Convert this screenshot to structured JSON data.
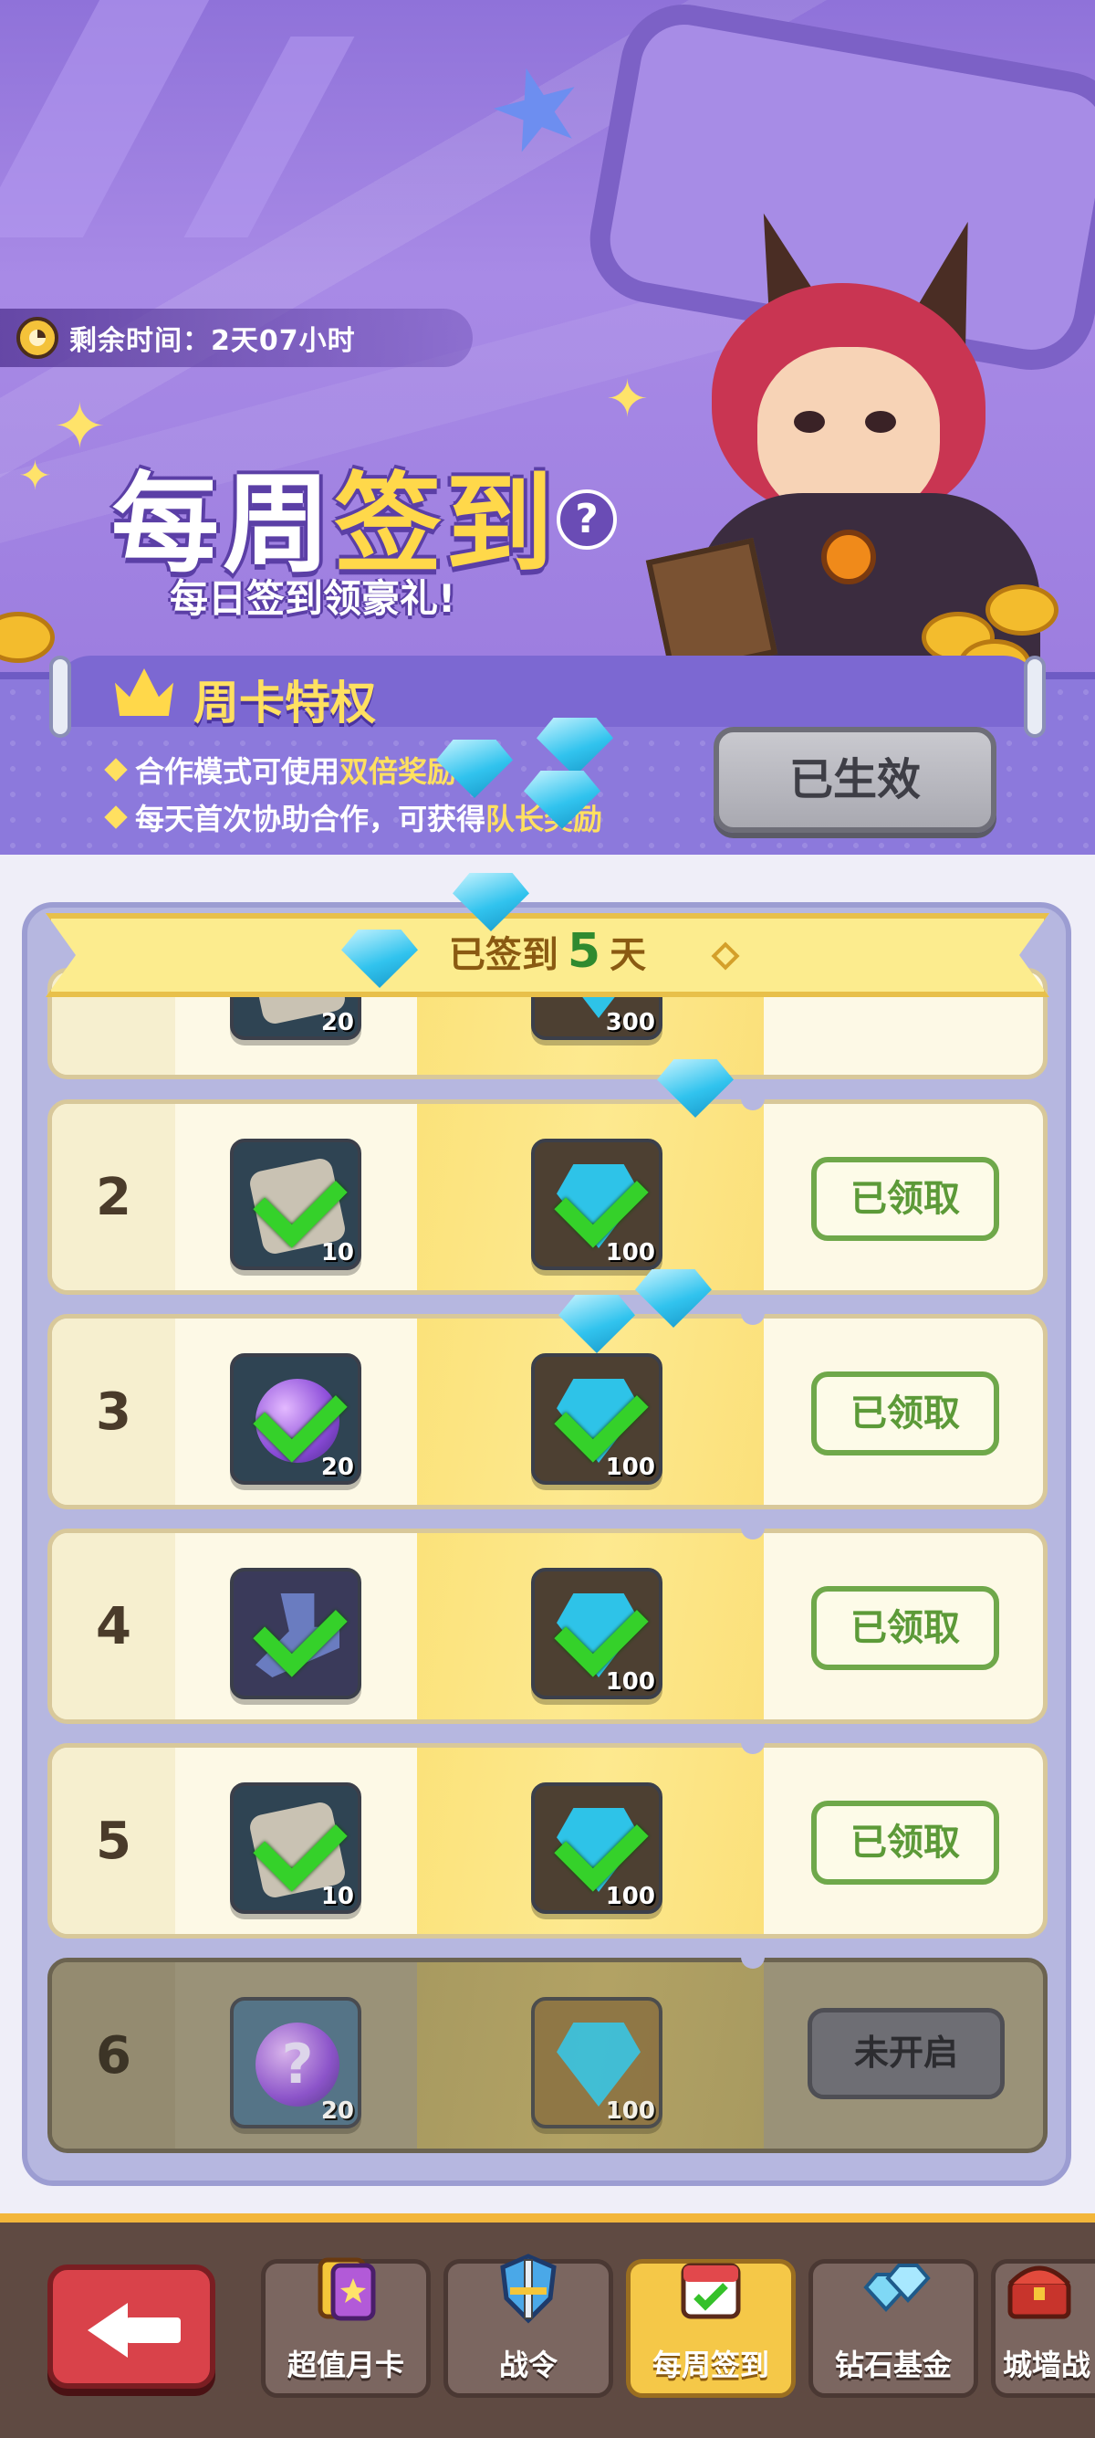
{
  "header": {
    "timer_label": "剩余时间：2天07小时",
    "title_part1": "每周",
    "title_part2": "签到",
    "help_icon": "question-icon",
    "help_glyph": "?",
    "subtitle": "每日签到领豪礼!"
  },
  "weekly_card": {
    "title": "周卡特权",
    "perk1_prefix": "合作模式可使用",
    "perk1_highlight": "双倍奖励",
    "perk2_prefix": "每天首次协助合作，可获得",
    "perk2_highlight": "队长奖励",
    "status_button": "已生效"
  },
  "progress": {
    "prefix": "已签到",
    "days": "5",
    "suffix": "天"
  },
  "rows": [
    {
      "day": "",
      "item1_qty": "20",
      "item2_qty": "300",
      "item1_icon": "scroll-icon",
      "item2_icon": "diamond-icon"
    },
    {
      "day": "2",
      "item1_qty": "10",
      "item2_qty": "100",
      "item1_icon": "scroll-icon",
      "item2_icon": "diamond-icon",
      "button": "已领取",
      "claimed": true
    },
    {
      "day": "3",
      "item1_qty": "20",
      "item2_qty": "100",
      "item1_icon": "mystery-orb-icon",
      "item2_icon": "diamond-icon",
      "button": "已领取",
      "claimed": true
    },
    {
      "day": "4",
      "item1_qty": "",
      "item2_qty": "100",
      "item1_icon": "hammer-icon",
      "item2_icon": "diamond-icon",
      "button": "已领取",
      "claimed": true
    },
    {
      "day": "5",
      "item1_qty": "10",
      "item2_qty": "100",
      "item1_icon": "scroll-icon",
      "item2_icon": "diamond-icon",
      "button": "已领取",
      "claimed": true
    },
    {
      "day": "6",
      "item1_qty": "20",
      "item2_qty": "100",
      "item1_icon": "mystery-orb-icon",
      "item2_icon": "diamond-icon",
      "button": "未开启",
      "claimed": false,
      "item1_glyph": "?"
    }
  ],
  "nav": {
    "back_icon": "back-arrow-icon",
    "tabs": [
      {
        "label": "超值月卡",
        "icon": "monthly-card-icon"
      },
      {
        "label": "战令",
        "icon": "battle-pass-icon"
      },
      {
        "label": "每周签到",
        "icon": "calendar-check-icon",
        "active": true
      },
      {
        "label": "钻石基金",
        "icon": "diamond-pile-icon"
      },
      {
        "label": "城墙战",
        "icon": "treasure-chest-icon"
      }
    ]
  },
  "colors": {
    "banner": "#9c7ddf",
    "accent_yellow": "#ffd84a",
    "claim_green": "#6fa84a",
    "nav_bg": "#5f4a42",
    "back_red": "#d9424a"
  }
}
